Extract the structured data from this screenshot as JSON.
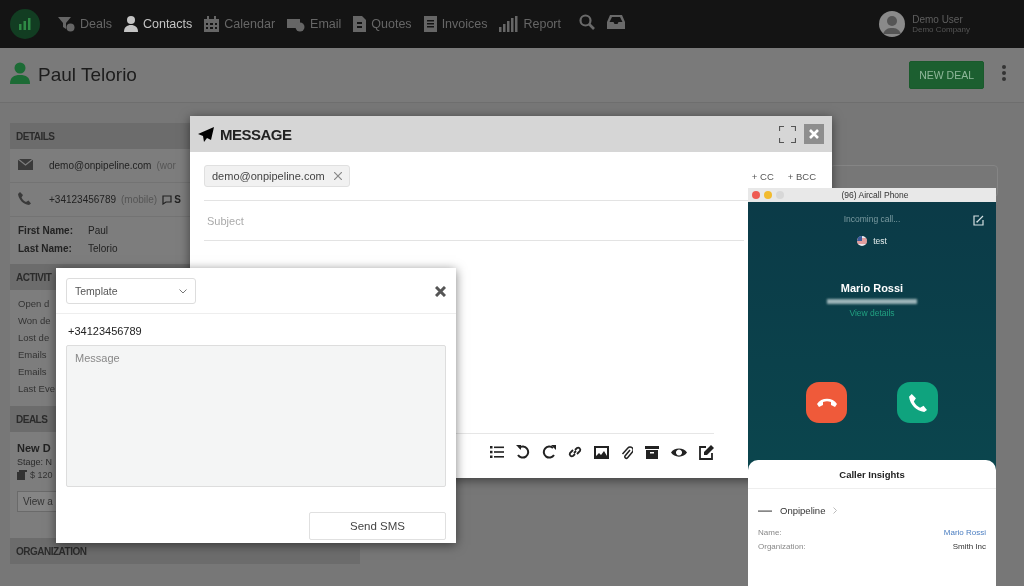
{
  "nav": {
    "items": [
      {
        "label": "Deals",
        "selected": false
      },
      {
        "label": "Contacts",
        "selected": true
      },
      {
        "label": "Calendar",
        "selected": false
      },
      {
        "label": "Email",
        "selected": false
      },
      {
        "label": "Quotes",
        "selected": false
      },
      {
        "label": "Invoices",
        "selected": false
      },
      {
        "label": "Report",
        "selected": false
      }
    ],
    "user": {
      "name": "Demo User",
      "company": "Demo Company"
    }
  },
  "contact_header": {
    "name": "Paul Telorio",
    "action": "NEW DEAL"
  },
  "details": {
    "title": "DETAILS",
    "email": "demo@onpipeline.com",
    "email_type": "(wor",
    "phone": "+34123456789",
    "phone_type": "(mobile)",
    "sms_link": "S",
    "fields": [
      {
        "label": "First Name:",
        "value": "Paul"
      },
      {
        "label": "Last Name:",
        "value": "Telorio"
      }
    ]
  },
  "activities": {
    "title": "ACTIVIT",
    "items": [
      "Open d",
      "Won de",
      "Lost de",
      "Emails",
      "Emails",
      "Last Eve"
    ]
  },
  "deals": {
    "title": "DEALS",
    "deal_name": "New D",
    "stage": "Stage: N",
    "amount": "$ 120",
    "button": "View a"
  },
  "organization": {
    "title": "ORGANIZATION"
  },
  "message_window": {
    "title": "MESSAGE",
    "recipients": [
      {
        "email": "demo@onpipeline.com"
      }
    ],
    "cc": "+ CC",
    "bcc": "+ BCC",
    "subject_placeholder": "Subject"
  },
  "sms_dialog": {
    "template_placeholder": "Template",
    "phone": "+34123456789",
    "message_placeholder": "Message",
    "send": "Send SMS"
  },
  "aircall": {
    "window_title": "(96) Aircall Phone",
    "status": "Incoming call...",
    "line": "test",
    "caller": "Mario Rossi",
    "details_link": "View details",
    "insights": {
      "title": "Caller Insights",
      "company": "Onpipeline",
      "fields": [
        {
          "label": "Name:",
          "value": "Mario Rossi",
          "kind": "link"
        },
        {
          "label": "Organization:",
          "value": "Smith Inc",
          "kind": "text"
        }
      ]
    }
  }
}
